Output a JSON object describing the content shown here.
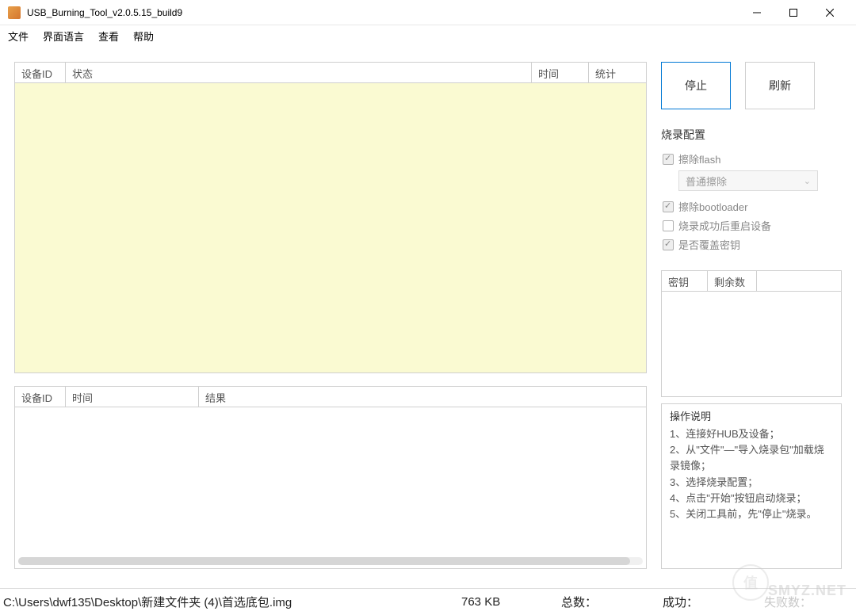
{
  "window": {
    "title": "USB_Burning_Tool_v2.0.5.15_build9"
  },
  "menu": {
    "file": "文件",
    "ui_language": "界面语言",
    "view": "查看",
    "help": "帮助"
  },
  "device_table": {
    "headers": {
      "device_id": "设备ID",
      "status": "状态",
      "time": "时间",
      "stats": "统计"
    }
  },
  "result_table": {
    "headers": {
      "device_id": "设备ID",
      "time": "时间",
      "result": "结果"
    }
  },
  "actions": {
    "stop": "停止",
    "refresh": "刷新"
  },
  "config": {
    "title": "烧录配置",
    "erase_flash": "擦除flash",
    "erase_mode": "普通擦除",
    "erase_bootloader": "擦除bootloader",
    "reboot_after": "烧录成功后重启设备",
    "overwrite_key": "是否覆盖密钥"
  },
  "key_table": {
    "headers": {
      "key": "密钥",
      "remaining": "剩余数"
    }
  },
  "instructions": {
    "title": "操作说明",
    "step1": "1、连接好HUB及设备；",
    "step2": "2、从\"文件\"—\"导入烧录包\"加载烧录镜像；",
    "step3": "3、选择烧录配置；",
    "step4": "4、点击\"开始\"按钮启动烧录；",
    "step5": "5、关闭工具前，先\"停止\"烧录。"
  },
  "status": {
    "path": "C:\\Users\\dwf135\\Desktop\\新建文件夹 (4)\\首选底包.img",
    "filesize": "763 KB",
    "total_label": "总数：",
    "success_label": "成功：",
    "fail_label": "失败数："
  },
  "watermark": "SMYZ.NET"
}
